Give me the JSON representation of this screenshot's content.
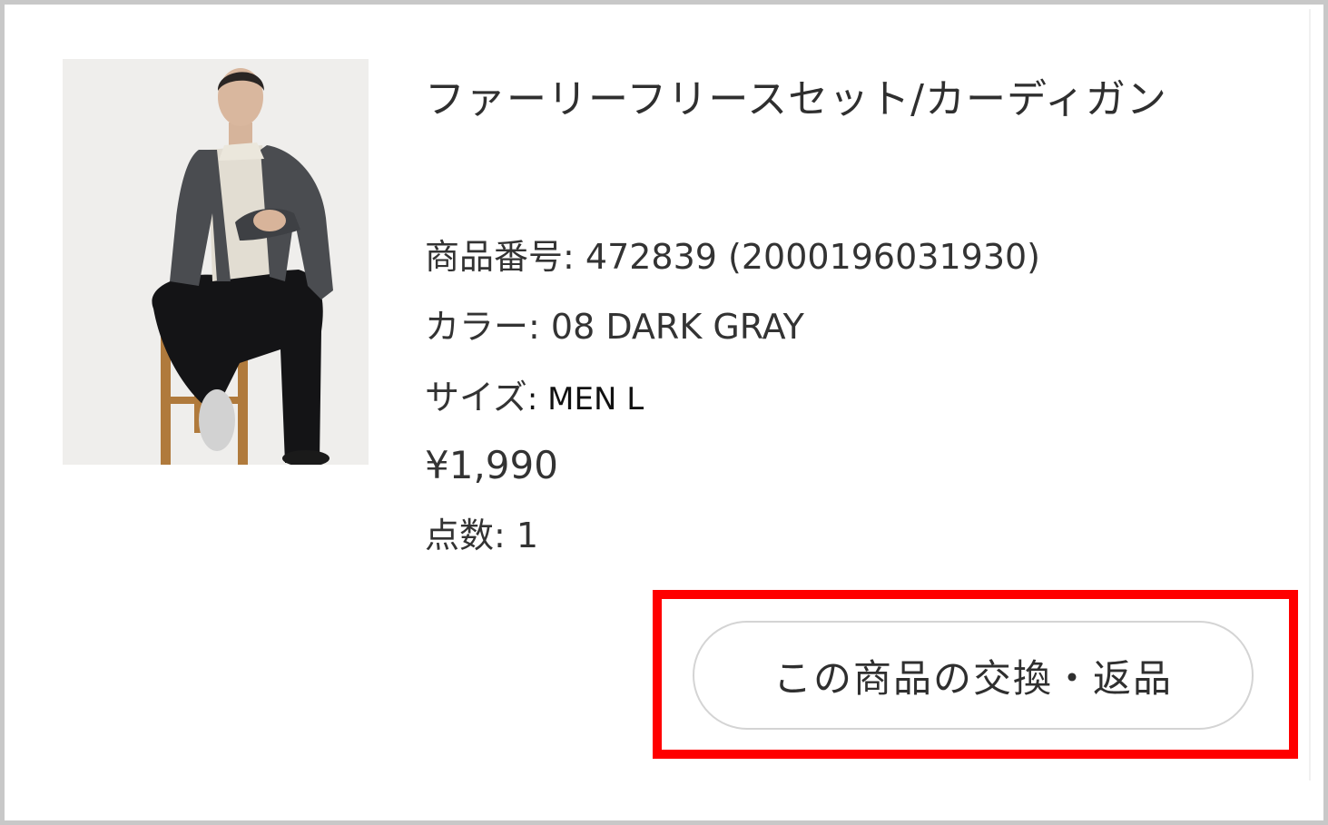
{
  "product": {
    "name": "ファーリーフリースセット/カーディガン",
    "number_label": "商品番号",
    "number_value": "472839 (2000196031930)",
    "color_label": "カラー",
    "color_value": "08 DARK GRAY",
    "size_label": "サイズ",
    "size_value": "MEN L",
    "price": "¥1,990",
    "quantity_label": "点数",
    "quantity_value": "1",
    "image_icon": "product-photo-man-seated-on-stool-wearing-dark-gray-cardigan"
  },
  "actions": {
    "return_button_label": "この商品の交換・返品"
  },
  "colors": {
    "highlight": "#ff0000",
    "button_border": "#d4d4d4",
    "frame_border": "#c8c8c8",
    "text": "#333333"
  }
}
